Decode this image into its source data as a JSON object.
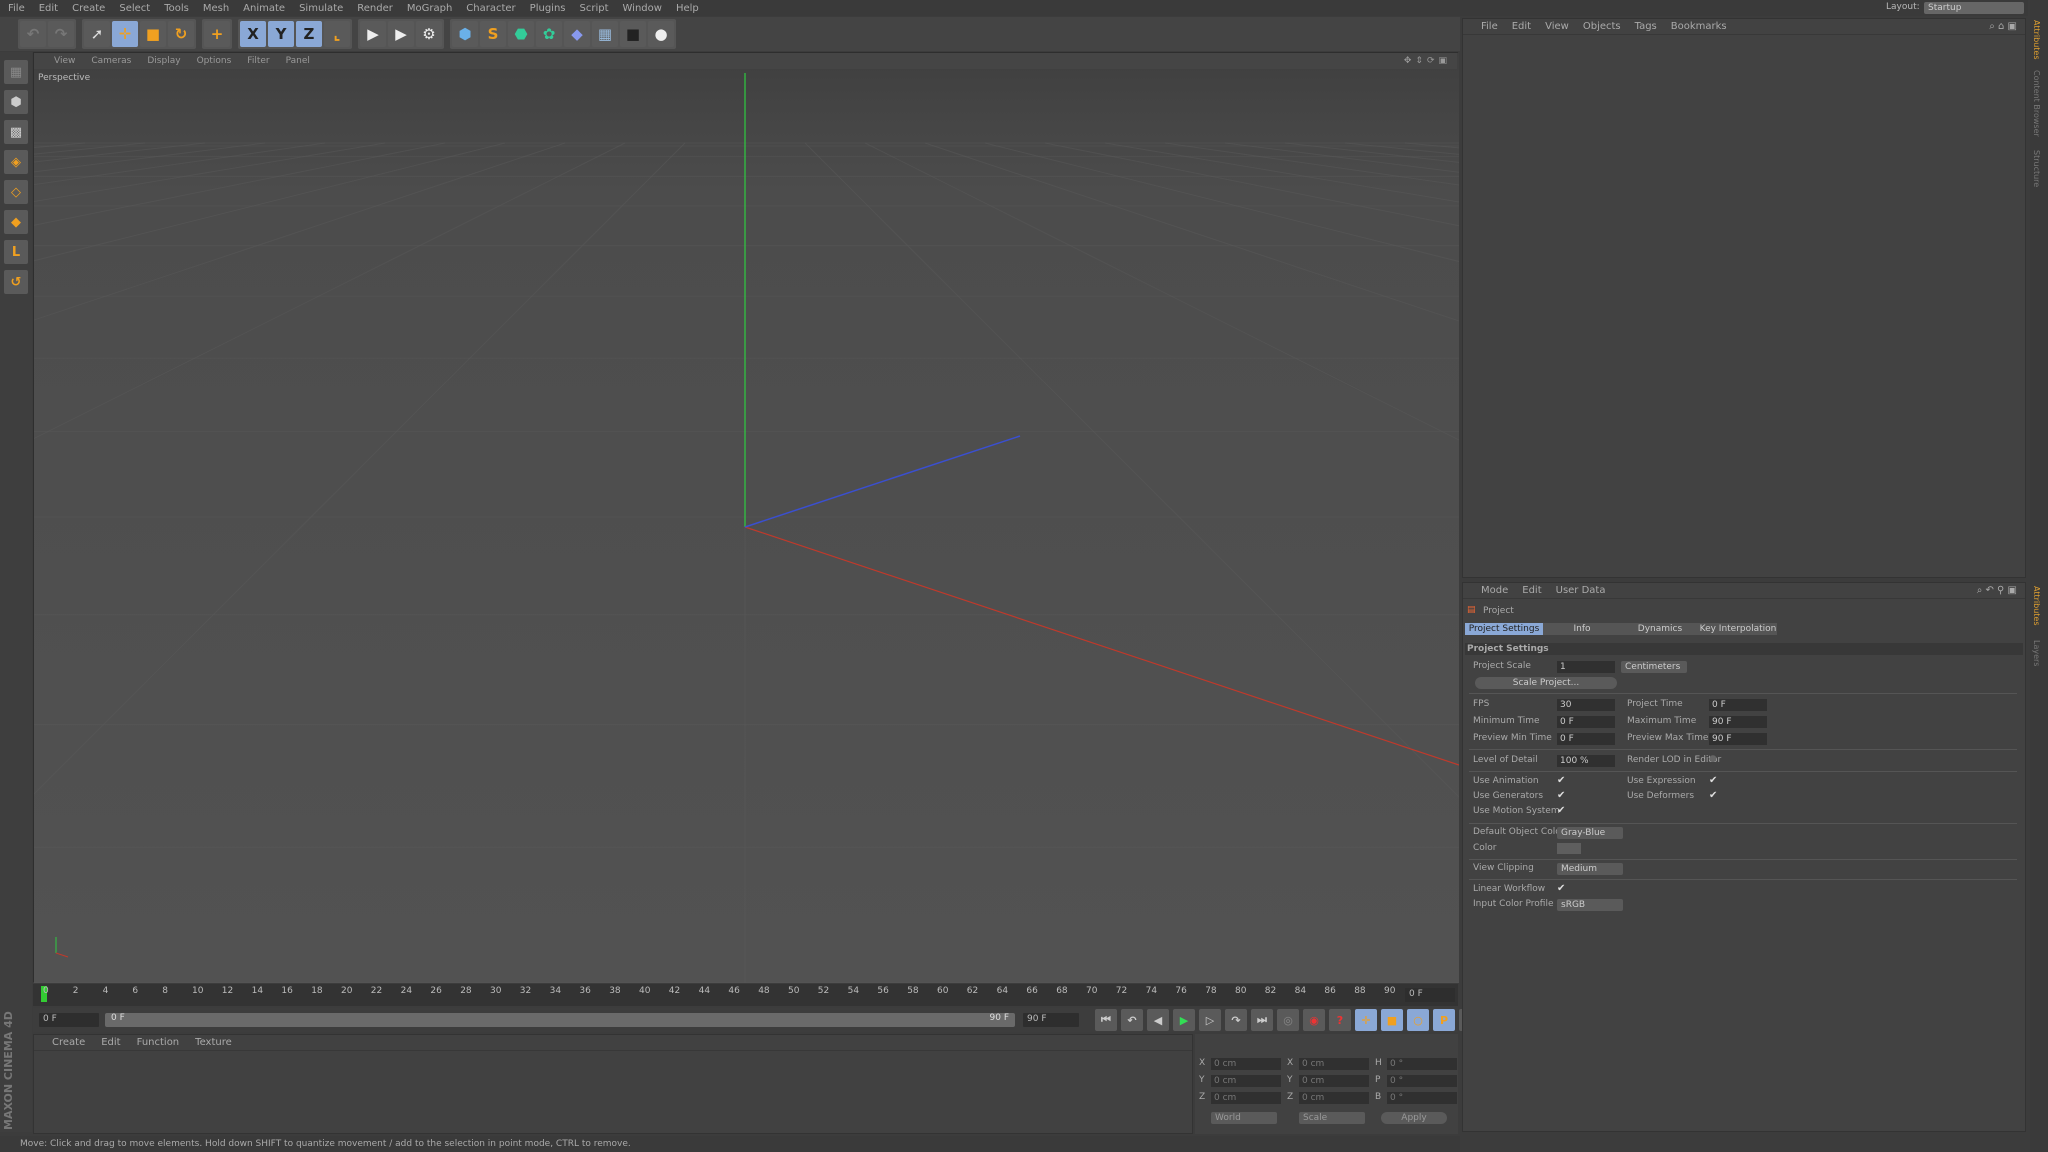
{
  "menu": [
    "File",
    "Edit",
    "Create",
    "Select",
    "Tools",
    "Mesh",
    "Animate",
    "Simulate",
    "Render",
    "MoGraph",
    "Character",
    "Plugins",
    "Script",
    "Window",
    "Help"
  ],
  "layout": {
    "label": "Layout:",
    "value": "Startup"
  },
  "toolbar_icons": [
    "undo-icon",
    "redo-icon",
    "live-selection-icon",
    "move-icon",
    "scale-icon",
    "rotate-icon",
    "recent-tool-icon",
    "x-axis-icon",
    "y-axis-icon",
    "z-axis-icon",
    "coordinate-system-icon",
    "render-view-icon",
    "render-picture-viewer-icon",
    "render-settings-icon",
    "cube-icon",
    "spline-icon",
    "nurbs-icon",
    "array-icon",
    "deformer-icon",
    "floor-icon",
    "camera-icon",
    "light-icon"
  ],
  "viewport": {
    "menu": [
      "View",
      "Cameras",
      "Display",
      "Options",
      "Filter",
      "Panel"
    ],
    "label": "Perspective"
  },
  "timeline": {
    "ticks": [
      "0",
      "2",
      "4",
      "6",
      "8",
      "10",
      "12",
      "14",
      "16",
      "18",
      "20",
      "22",
      "24",
      "26",
      "28",
      "30",
      "32",
      "34",
      "36",
      "38",
      "40",
      "42",
      "44",
      "46",
      "48",
      "50",
      "52",
      "54",
      "56",
      "58",
      "60",
      "62",
      "64",
      "66",
      "68",
      "70",
      "72",
      "74",
      "76",
      "78",
      "80",
      "82",
      "84",
      "86",
      "88",
      "90"
    ],
    "current": "0 F",
    "start": "0 F",
    "range_start": "0 F",
    "range_end": "90 F",
    "end": "90 F"
  },
  "material": {
    "menu": [
      "Create",
      "Edit",
      "Function",
      "Texture"
    ]
  },
  "coords": {
    "rows": [
      [
        "X",
        "0 cm",
        "X",
        "0 cm",
        "H",
        "0 °"
      ],
      [
        "Y",
        "0 cm",
        "Y",
        "0 cm",
        "P",
        "0 °"
      ],
      [
        "Z",
        "0 cm",
        "Z",
        "0 cm",
        "B",
        "0 °"
      ]
    ],
    "mode": "World",
    "scale": "Scale",
    "apply": "Apply"
  },
  "status": "Move: Click and drag to move elements. Hold down SHIFT to quantize movement / add to the selection in point mode, CTRL to remove.",
  "brand": "MAXON CINEMA 4D",
  "objmgr": {
    "menu": [
      "File",
      "Edit",
      "View",
      "Objects",
      "Tags",
      "Bookmarks"
    ]
  },
  "attr": {
    "menu": [
      "Mode",
      "Edit",
      "User Data"
    ],
    "title": "Project",
    "tabs": [
      "Project Settings",
      "Info",
      "Dynamics",
      "Key Interpolation"
    ],
    "section": "Project Settings",
    "project_scale": {
      "label": "Project Scale",
      "value": "1",
      "unit": "Centimeters"
    },
    "scale_btn": "Scale Project...",
    "fps": {
      "label": "FPS",
      "value": "30"
    },
    "project_time": {
      "label": "Project Time",
      "value": "0 F"
    },
    "min_time": {
      "label": "Minimum Time",
      "value": "0 F"
    },
    "max_time": {
      "label": "Maximum Time",
      "value": "90 F"
    },
    "prev_min": {
      "label": "Preview Min Time",
      "value": "0 F"
    },
    "prev_max": {
      "label": "Preview Max Time",
      "value": "90 F"
    },
    "lod": {
      "label": "Level of Detail",
      "value": "100 %"
    },
    "render_lod": {
      "label": "Render LOD in Editor",
      "checked": false
    },
    "checks": [
      {
        "label": "Use Animation",
        "checked": true
      },
      {
        "label": "Use Expression",
        "checked": true
      },
      {
        "label": "Use Generators",
        "checked": true
      },
      {
        "label": "Use Deformers",
        "checked": true
      },
      {
        "label": "Use Motion System",
        "checked": true
      }
    ],
    "obj_color": {
      "label": "Default Object Color",
      "value": "Gray-Blue"
    },
    "color": {
      "label": "Color"
    },
    "clipping": {
      "label": "View Clipping",
      "value": "Medium"
    },
    "linear": {
      "label": "Linear Workflow",
      "checked": true
    },
    "profile": {
      "label": "Input Color Profile",
      "value": "sRGB"
    }
  },
  "side_tabs": [
    "Attributes",
    "Layers",
    "Content Browser",
    "Structure"
  ],
  "colors": {
    "accent": "#8aa8d6",
    "x_axis": "#c0392b",
    "y_axis": "#2ecc40",
    "z_axis": "#3a4fd0"
  }
}
